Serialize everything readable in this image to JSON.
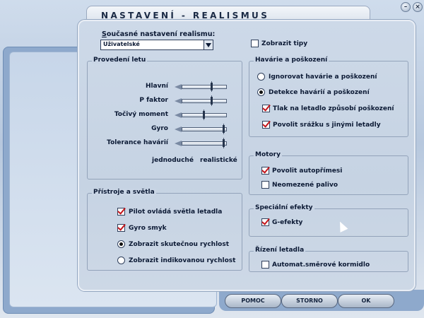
{
  "window": {
    "title": "NASTAVENÍ - REALISMUS",
    "minimize_glyph": "–",
    "close_glyph": "×"
  },
  "realism": {
    "label": "Současné nastavení realismu:",
    "selected": "Uživatelské"
  },
  "show_tips": {
    "label": "Zobrazit tipy",
    "checked": false
  },
  "flight": {
    "title": "Provedení letu",
    "sliders": [
      {
        "label": "Hlavní",
        "value": 0.67
      },
      {
        "label": "P faktor",
        "value": 0.67
      },
      {
        "label": "Točivý moment",
        "value": 0.5
      },
      {
        "label": "Gyro",
        "value": 0.95
      },
      {
        "label": "Tolerance havárií",
        "value": 0.95
      }
    ],
    "scale_min": "jednoduché",
    "scale_max": "realistické"
  },
  "crash": {
    "title": "Havárie a poškození",
    "options": [
      {
        "label": "Ignorovat havárie a poškození",
        "selected": false
      },
      {
        "label": "Detekce havárií a poškození",
        "selected": true
      }
    ],
    "checks": [
      {
        "label": "Tlak na letadlo způsobí poškození",
        "checked": true
      },
      {
        "label": "Povolit srážku s jinými letadly",
        "checked": true
      }
    ]
  },
  "instruments": {
    "title": "Přístroje a světla",
    "checks": [
      {
        "label": "Pilot ovládá světla letadla",
        "checked": true
      },
      {
        "label": "Gyro smyk",
        "checked": true
      }
    ],
    "options": [
      {
        "label": "Zobrazit skutečnou rychlost",
        "selected": true
      },
      {
        "label": "Zobrazit indikovanou rychlost",
        "selected": false
      }
    ]
  },
  "engines": {
    "title": "Motory",
    "checks": [
      {
        "label": "Povolit autopřímesi",
        "checked": true
      },
      {
        "label": "Neomezené palivo",
        "checked": false
      }
    ]
  },
  "effects": {
    "title": "Speciální efekty",
    "checks": [
      {
        "label": "G-efekty",
        "checked": true
      }
    ]
  },
  "control": {
    "title": "Řízení letadla",
    "checks": [
      {
        "label": "Automat.směrové kormidlo",
        "checked": false
      }
    ]
  },
  "buttons": {
    "help": "POMOC",
    "cancel": "STORNO",
    "ok": "OK"
  }
}
